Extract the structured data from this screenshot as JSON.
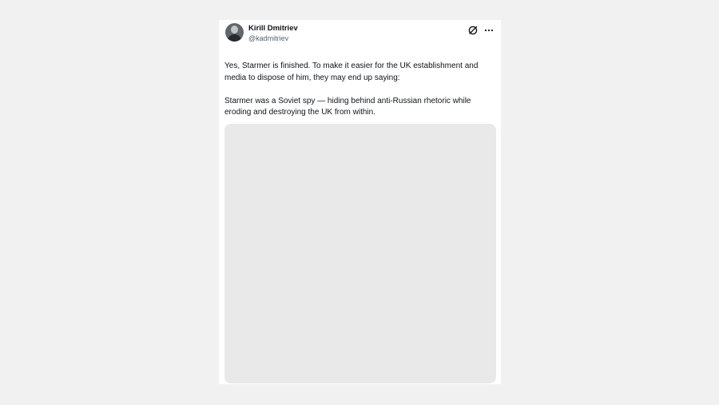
{
  "tweet": {
    "author": {
      "display_name": "Kirill Dmitriev",
      "handle": "@kadmitriev"
    },
    "actions": {
      "grok_icon": "grok-icon",
      "more_icon": "more-options-icon"
    },
    "paragraphs": [
      "Yes, Starmer is finished. To make it easier for the UK establishment and media to dispose of him, they may end up saying:",
      "Starmer was a Soviet spy — hiding behind anti-Russian rhetoric while eroding and destroying the UK from within."
    ]
  }
}
